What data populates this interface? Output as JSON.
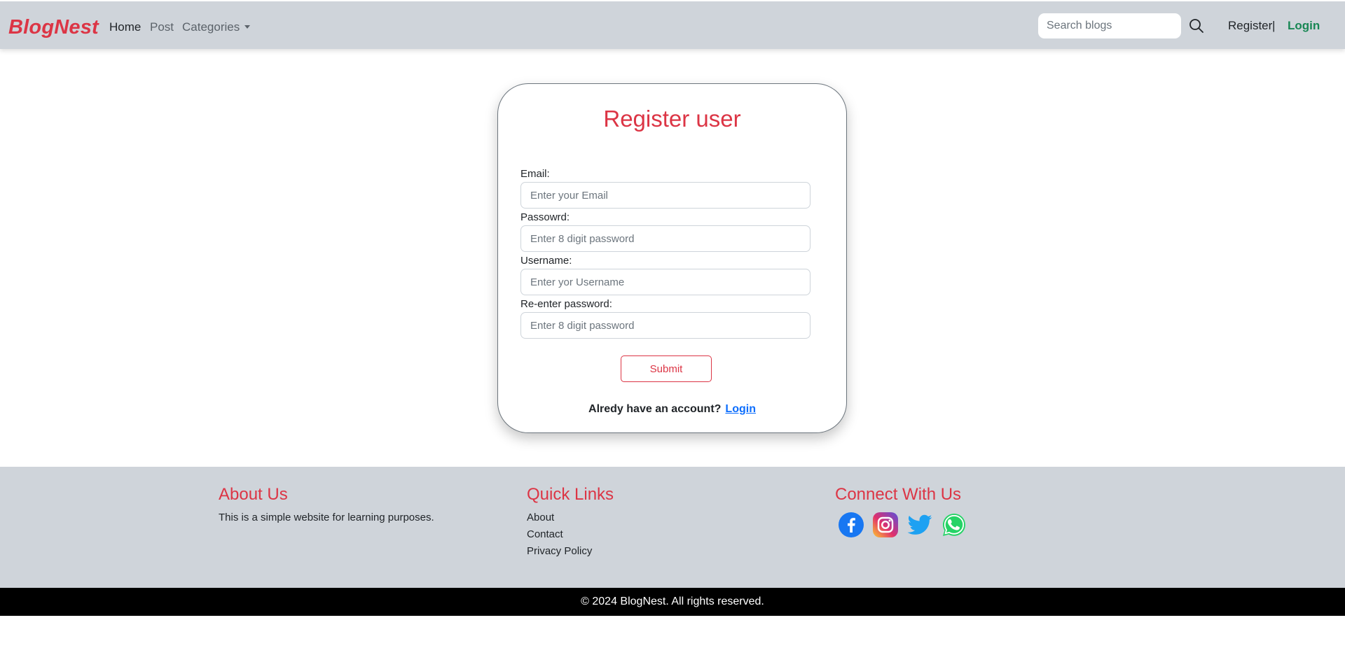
{
  "colors": {
    "accent": "#dc3545",
    "login": "#198754",
    "link": "#0d6efd",
    "nav_bg": "#cfd4da"
  },
  "navbar": {
    "brand": "BlogNest",
    "links": [
      {
        "label": "Home",
        "active": true
      },
      {
        "label": "Post",
        "active": false
      },
      {
        "label": "Categories",
        "active": false,
        "dropdown": true
      }
    ],
    "search_placeholder": "Search blogs",
    "search_icon": "search-icon",
    "register_label": "Register",
    "separator": "|",
    "login_label": "Login"
  },
  "form": {
    "title": "Register user",
    "fields": [
      {
        "label": "Email:",
        "placeholder": "Enter your Email",
        "value": ""
      },
      {
        "label": "Passowrd:",
        "placeholder": "Enter 8 digit password",
        "value": ""
      },
      {
        "label": "Username:",
        "placeholder": "Enter yor Username",
        "value": ""
      },
      {
        "label": "Re-enter password:",
        "placeholder": "Enter 8 digit password",
        "value": ""
      }
    ],
    "submit_label": "Submit",
    "account_prompt": "Alredy have an account?",
    "login_link": "Login"
  },
  "footer": {
    "about": {
      "heading": "About Us",
      "text": "This is a simple website for learning purposes."
    },
    "quick_links": {
      "heading": "Quick Links",
      "items": [
        "About",
        "Contact",
        "Privacy Policy"
      ]
    },
    "connect": {
      "heading": "Connect With Us",
      "icons": [
        "facebook-icon",
        "instagram-icon",
        "twitter-icon",
        "whatsapp-icon"
      ]
    },
    "copyright": "© 2024 BlogNest. All rights reserved."
  }
}
